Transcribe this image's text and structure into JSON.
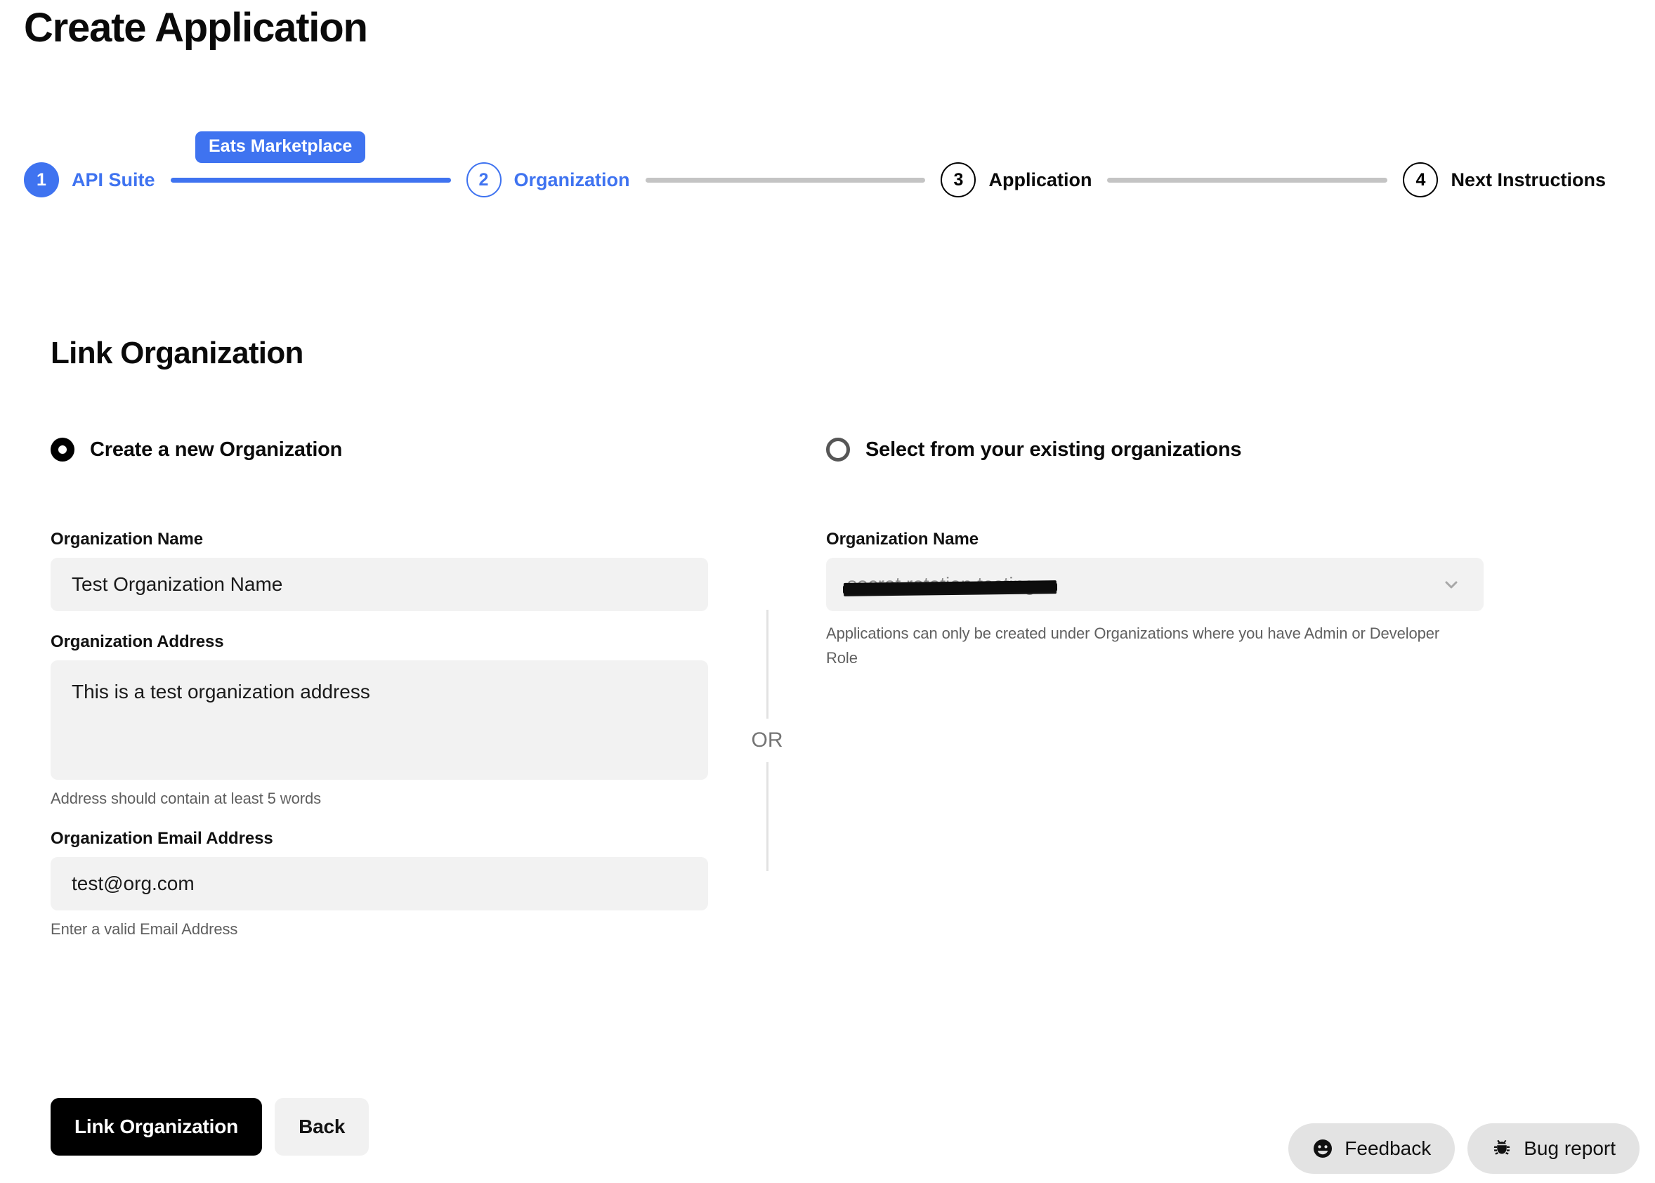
{
  "page": {
    "title": "Create Application",
    "section_title": "Link Organization"
  },
  "stepper": {
    "badge": "Eats Marketplace",
    "steps": [
      {
        "number": "1",
        "label": "API Suite",
        "state": "filled"
      },
      {
        "number": "2",
        "label": "Organization",
        "state": "current"
      },
      {
        "number": "3",
        "label": "Application",
        "state": "upcoming"
      },
      {
        "number": "4",
        "label": "Next Instructions",
        "state": "upcoming"
      }
    ],
    "connectors": [
      "done",
      "todo",
      "todo"
    ]
  },
  "divider": {
    "or": "OR"
  },
  "create_org": {
    "radio_label": "Create a new Organization",
    "selected": true,
    "name": {
      "label": "Organization Name",
      "value": "Test Organization Name",
      "placeholder": "Organization Name"
    },
    "address": {
      "label": "Organization Address",
      "value": "This is a test organization address",
      "placeholder": "Organization Address",
      "helper": "Address should contain at least 5 words"
    },
    "email": {
      "label": "Organization Email Address",
      "value": "test@org.com",
      "placeholder": "Organization Email Address",
      "helper": "Enter a valid Email Address"
    }
  },
  "existing_org": {
    "radio_label": "Select from your existing organizations",
    "selected": false,
    "select": {
      "label": "Organization Name",
      "value": "secret rotation testing",
      "helper": "Applications can only be created under Organizations where you have Admin or Developer Role",
      "chevron_icon": "chevron-down-icon"
    }
  },
  "actions": {
    "primary": "Link Organization",
    "secondary": "Back"
  },
  "floating": {
    "feedback": {
      "label": "Feedback",
      "icon": "smiley-face-icon"
    },
    "bug_report": {
      "label": "Bug report",
      "icon": "bug-icon"
    }
  },
  "colors": {
    "accent_blue": "#3f73f0",
    "connector_done": "#3f73f0",
    "connector_todo": "#c4c4c4",
    "input_bg": "#f2f2f2",
    "primary_button_bg": "#000000",
    "secondary_button_bg": "#f1f1f1",
    "pill_bg": "#e3e3e3",
    "helper_text": "#5f5f5f"
  }
}
